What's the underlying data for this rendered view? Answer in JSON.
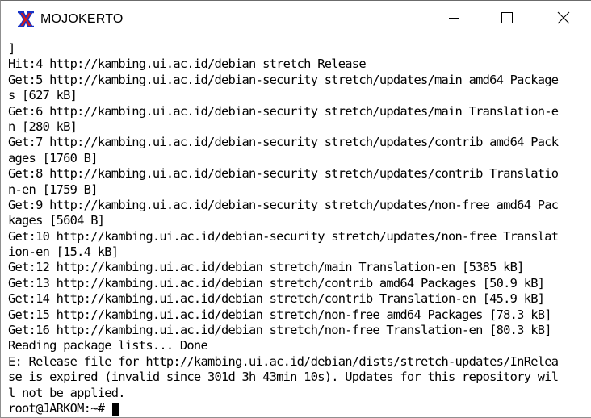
{
  "window": {
    "title": "MOJOKERTO",
    "app_icon": "x-letter-icon"
  },
  "controls": {
    "minimize_icon": "minimize-icon",
    "maximize_icon": "maximize-icon",
    "close_icon": "close-icon"
  },
  "colors": {
    "icon_red": "#d51b1b",
    "icon_blue": "#1633c8",
    "text": "#000000",
    "background": "#ffffff"
  },
  "terminal": {
    "lines": [
      "]",
      "Hit:4 http://kambing.ui.ac.id/debian stretch Release",
      "Get:5 http://kambing.ui.ac.id/debian-security stretch/updates/main amd64 Package",
      "s [627 kB]",
      "Get:6 http://kambing.ui.ac.id/debian-security stretch/updates/main Translation-e",
      "n [280 kB]",
      "Get:7 http://kambing.ui.ac.id/debian-security stretch/updates/contrib amd64 Pack",
      "ages [1760 B]",
      "Get:8 http://kambing.ui.ac.id/debian-security stretch/updates/contrib Translatio",
      "n-en [1759 B]",
      "Get:9 http://kambing.ui.ac.id/debian-security stretch/updates/non-free amd64 Pac",
      "kages [5604 B]",
      "Get:10 http://kambing.ui.ac.id/debian-security stretch/updates/non-free Translat",
      "ion-en [15.4 kB]",
      "Get:12 http://kambing.ui.ac.id/debian stretch/main Translation-en [5385 kB]",
      "Get:13 http://kambing.ui.ac.id/debian stretch/contrib amd64 Packages [50.9 kB]",
      "Get:14 http://kambing.ui.ac.id/debian stretch/contrib Translation-en [45.9 kB]",
      "Get:15 http://kambing.ui.ac.id/debian stretch/non-free amd64 Packages [78.3 kB]",
      "Get:16 http://kambing.ui.ac.id/debian stretch/non-free Translation-en [80.3 kB]",
      "Reading package lists... Done",
      "E: Release file for http://kambing.ui.ac.id/debian/dists/stretch-updates/InRelea",
      "se is expired (invalid since 301d 3h 43min 10s). Updates for this repository wil",
      "l not be applied."
    ],
    "prompt": "root@JARKOM:~# "
  }
}
